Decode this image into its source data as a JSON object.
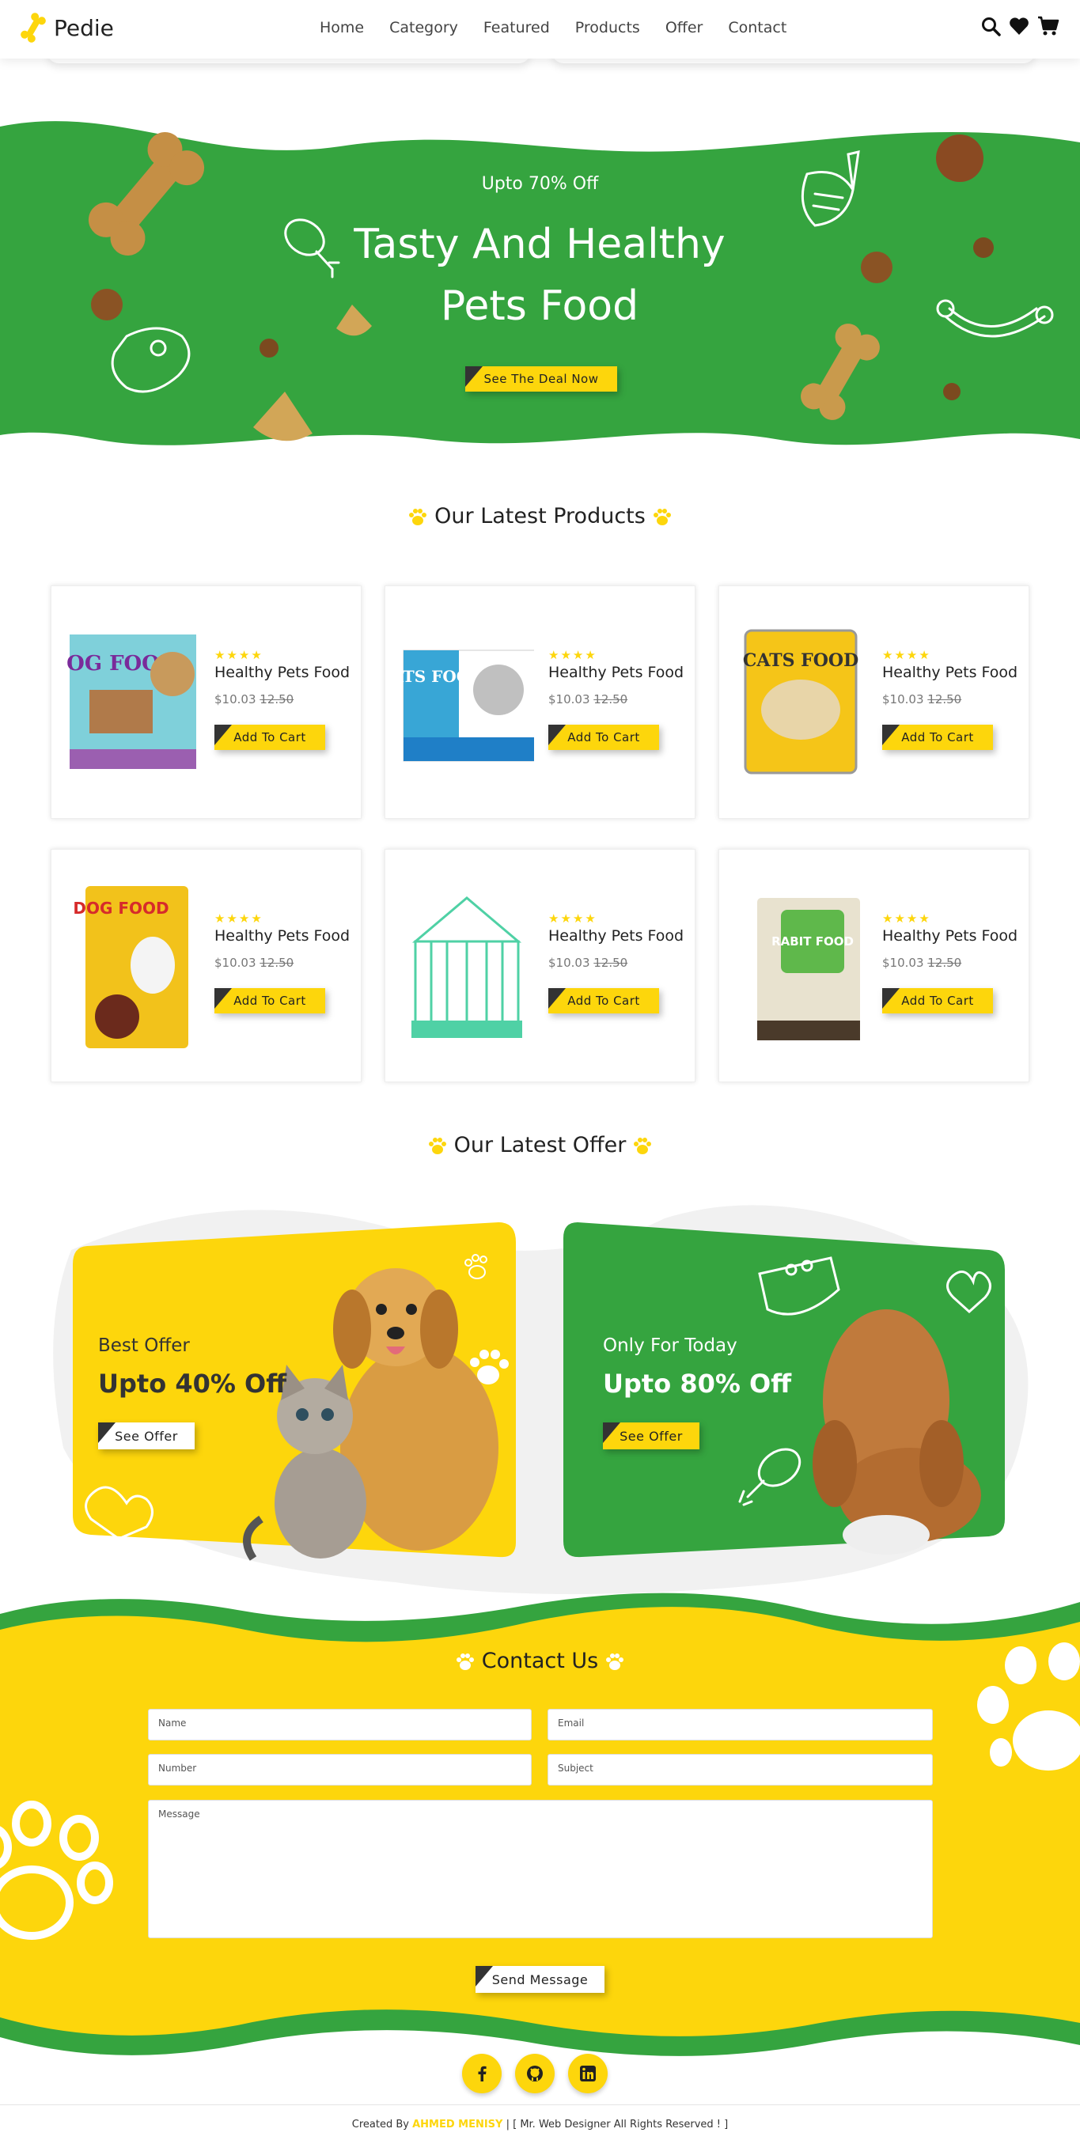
{
  "header": {
    "logo_text": "Pedie",
    "nav": [
      "Home",
      "Category",
      "Featured",
      "Products",
      "Offer",
      "Contact"
    ],
    "icons": [
      "search-icon",
      "heart-icon",
      "cart-icon"
    ]
  },
  "hero": {
    "subtitle": "Upto 70% Off",
    "title_line1": "Tasty And Healthy",
    "title_line2": "Pets Food",
    "button": "See The Deal Now"
  },
  "products": {
    "title": "Our Latest Products",
    "items": [
      {
        "name": "Healthy Pets Food",
        "price": "$10.03",
        "old_price": "12.50",
        "stars": "★★★★",
        "button": "Add To Cart",
        "image_text": "DOG FOOD"
      },
      {
        "name": "Healthy Pets Food",
        "price": "$10.03",
        "old_price": "12.50",
        "stars": "★★★★",
        "button": "Add To Cart",
        "image_text": "CATS FOOD"
      },
      {
        "name": "Healthy Pets Food",
        "price": "$10.03",
        "old_price": "12.50",
        "stars": "★★★★",
        "button": "Add To Cart",
        "image_text": "CATS FOOD"
      },
      {
        "name": "Healthy Pets Food",
        "price": "$10.03",
        "old_price": "12.50",
        "stars": "★★★★",
        "button": "Add To Cart",
        "image_text": "DOG FOOD"
      },
      {
        "name": "Healthy Pets Food",
        "price": "$10.03",
        "old_price": "12.50",
        "stars": "★★★★",
        "button": "Add To Cart",
        "image_text": ""
      },
      {
        "name": "Healthy Pets Food",
        "price": "$10.03",
        "old_price": "12.50",
        "stars": "★★★★",
        "button": "Add To Cart",
        "image_text": "RABIT FOOD"
      }
    ]
  },
  "offers": {
    "title": "Our Latest Offer",
    "cards": [
      {
        "label": "Best Offer",
        "headline": "Upto 40% Off",
        "button": "See Offer"
      },
      {
        "label": "Only For Today",
        "headline": "Upto 80% Off",
        "button": "See Offer"
      }
    ]
  },
  "contact": {
    "title": "Contact Us",
    "name_placeholder": "Name",
    "email_placeholder": "Email",
    "number_placeholder": "Number",
    "subject_placeholder": "Subject",
    "message_placeholder": "Message",
    "button": "Send Message"
  },
  "footer": {
    "social": [
      "facebook-icon",
      "github-icon",
      "linkedin-icon"
    ],
    "credit_prefix": "Created By ",
    "credit_name": "AHMED MENISY",
    "credit_suffix": " | [ Mr. Web Designer All Rights Reserved ! ]"
  },
  "colors": {
    "green": "#35a43f",
    "yellow": "#fdd60c",
    "dark": "#333333"
  }
}
